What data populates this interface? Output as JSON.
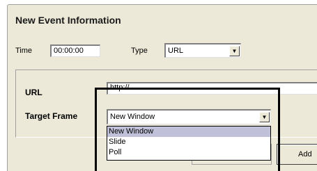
{
  "section_title": "New Event Information",
  "time": {
    "label": "Time",
    "value": "00:00:00"
  },
  "type": {
    "label": "Type",
    "selected": "URL"
  },
  "url": {
    "label": "URL",
    "value": "http://"
  },
  "target_frame": {
    "label": "Target Frame",
    "selected": "New Window",
    "options": [
      "New Window",
      "Slide",
      "Poll"
    ]
  },
  "buttons": {
    "add_label": "Add"
  },
  "icons": {
    "dropdown_arrow": "chevron-down-icon"
  }
}
